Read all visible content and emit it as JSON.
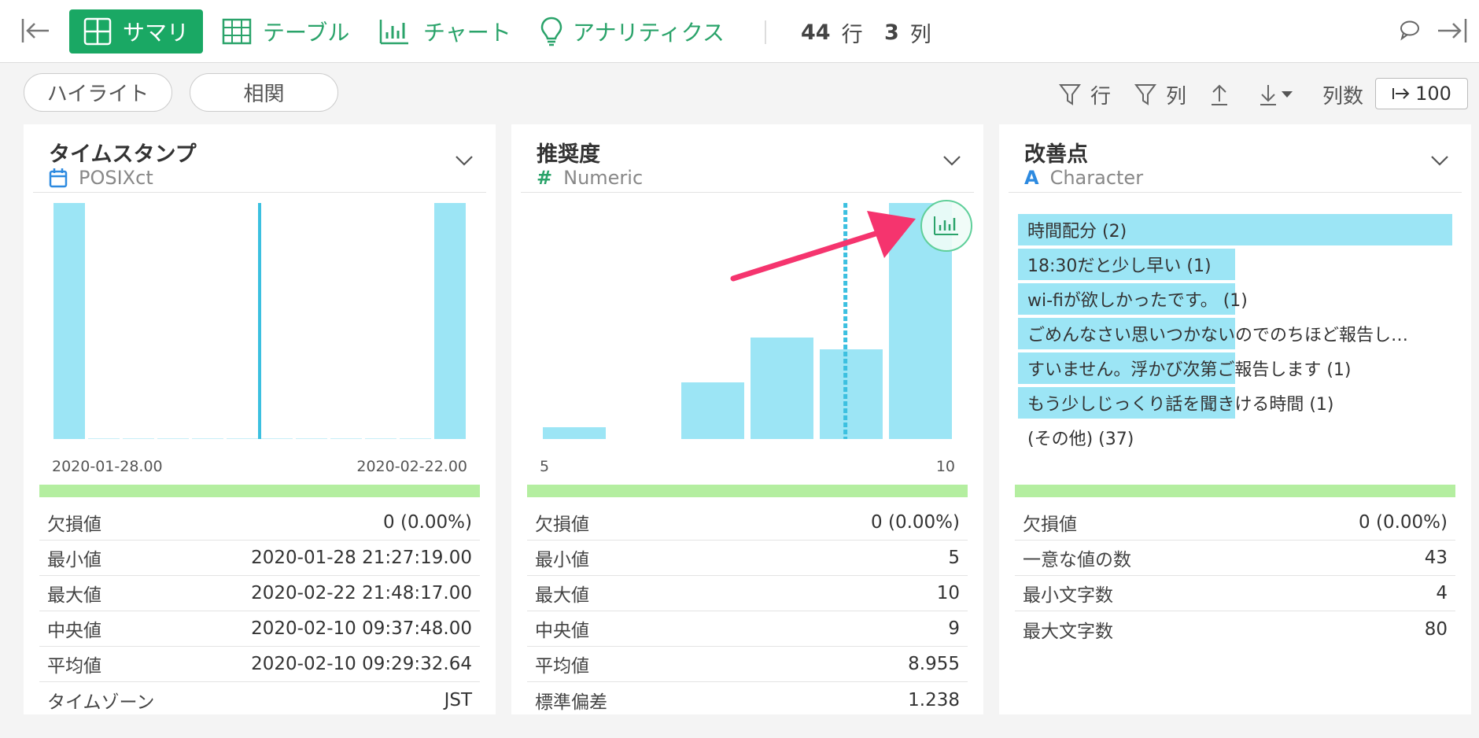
{
  "topbar": {
    "tabs": [
      {
        "label": "サマリ",
        "icon": "grid-icon",
        "active": true
      },
      {
        "label": "テーブル",
        "icon": "table-icon"
      },
      {
        "label": "チャート",
        "icon": "bar-chart-icon"
      },
      {
        "label": "アナリティクス",
        "icon": "lightbulb-icon"
      }
    ],
    "rows_count": "44",
    "rows_unit": "行",
    "cols_count": "3",
    "cols_unit": "列"
  },
  "toolbar": {
    "highlight_label": "ハイライト",
    "correlation_label": "相関",
    "row_filter_label": "行",
    "col_filter_label": "列",
    "columns_label": "列数",
    "columns_value": "100"
  },
  "colors": {
    "accent": "#1aa864",
    "bar": "#9ce5f5",
    "green_bar": "#b4eea0",
    "arrow": "#f5346e"
  },
  "cards": [
    {
      "title": "タイムスタンプ",
      "type": "POSIXct",
      "axis_min": "2020-01-28.00",
      "axis_max": "2020-02-22.00",
      "histogram": [
        1,
        0,
        0,
        0,
        0,
        0,
        0,
        0,
        0,
        0,
        0,
        1
      ],
      "median_marker_fraction": 0.5,
      "stats": [
        {
          "label": "欠損値",
          "value": "0 (0.00%)"
        },
        {
          "label": "最小値",
          "value": "2020-01-28 21:27:19.00"
        },
        {
          "label": "最大値",
          "value": "2020-02-22 21:48:17.00"
        },
        {
          "label": "中央値",
          "value": "2020-02-10 09:37:48.00"
        },
        {
          "label": "平均値",
          "value": "2020-02-10 09:29:32.64"
        },
        {
          "label": "タイムゾーン",
          "value": "JST"
        }
      ]
    },
    {
      "title": "推奨度",
      "type": "Numeric",
      "axis_min": "5",
      "axis_max": "10",
      "histogram": [
        0.05,
        0,
        0.24,
        0.43,
        0.38,
        1
      ],
      "mean_marker_fraction": 0.736,
      "stats": [
        {
          "label": "欠損値",
          "value": "0 (0.00%)"
        },
        {
          "label": "最小値",
          "value": "5"
        },
        {
          "label": "最大値",
          "value": "10"
        },
        {
          "label": "中央値",
          "value": "9"
        },
        {
          "label": "平均値",
          "value": "8.955"
        },
        {
          "label": "標準偏差",
          "value": "1.238"
        }
      ]
    },
    {
      "title": "改善点",
      "type": "Character",
      "categories": [
        {
          "label": "時間配分 (2)",
          "fraction": 1.0
        },
        {
          "label": "18:30だと少し早い (1)",
          "fraction": 0.5
        },
        {
          "label": "wi-fiが欲しかったです。 (1)",
          "fraction": 0.5
        },
        {
          "label": "ごめんなさい思いつかないのでのちほど報告し…",
          "fraction": 0.5
        },
        {
          "label": "すいません。浮かび次第ご報告します (1)",
          "fraction": 0.5
        },
        {
          "label": "もう少しじっくり話を聞きける時間 (1)",
          "fraction": 0.5
        },
        {
          "label": "(その他) (37)",
          "fraction": 0
        }
      ],
      "stats": [
        {
          "label": "欠損値",
          "value": "0 (0.00%)"
        },
        {
          "label": "一意な値の数",
          "value": "43"
        },
        {
          "label": "最小文字数",
          "value": "4"
        },
        {
          "label": "最大文字数",
          "value": "80"
        }
      ]
    }
  ]
}
